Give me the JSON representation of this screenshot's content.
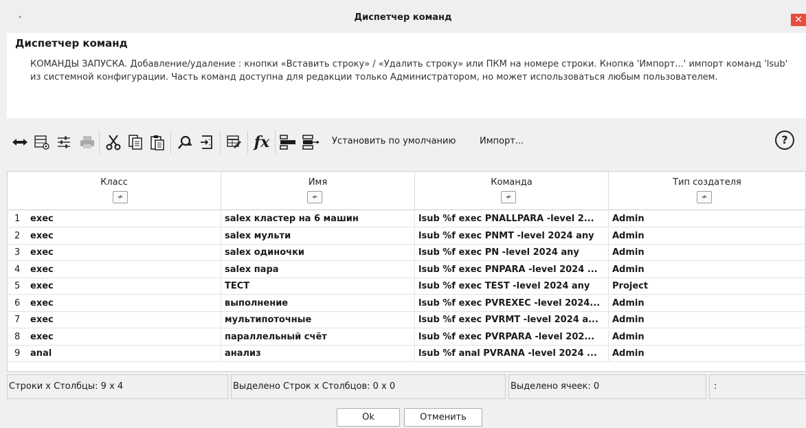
{
  "window": {
    "title": "Диспетчер команд",
    "close_glyph": "✕"
  },
  "header": {
    "heading": "Диспетчер команд",
    "description": "КОМАНДЫ ЗАПУСКА. Добавление/удаление : кнопки «Вставить строку» / «Удалить строку» или ПКМ на номере строки. Кнопка 'Импорт...' импорт команд 'lsub' из системной конфигурации. Часть команд доступна для редакции только Администратором, но может использоваться любым пользователем."
  },
  "toolbar": {
    "icons": [
      "resize-columns-icon",
      "view-table-icon",
      "settings-lines-icon",
      "print-icon",
      "cut-icon",
      "copy-icon",
      "paste-icon",
      "search-replace-icon",
      "goto-icon",
      "edit-table-icon",
      "function-icon",
      "insert-row-icon",
      "delete-row-icon"
    ],
    "set_default_label": "Установить по умолчанию",
    "import_label": "Импорт...",
    "help_glyph": "?"
  },
  "table": {
    "columns": [
      "Класс",
      "Имя",
      "Команда",
      "Тип создателя"
    ],
    "filter_glyph": "≁",
    "rows": [
      {
        "num": "1",
        "cls": "exec",
        "name": "salex кластер на 6 машин",
        "cmd": "lsub %f exec PNALLPARA -level 2...",
        "creator": "Admin"
      },
      {
        "num": "2",
        "cls": "exec",
        "name": "salex мульти",
        "cmd": "lsub %f exec PNMT -level 2024 any",
        "creator": "Admin"
      },
      {
        "num": "3",
        "cls": "exec",
        "name": "salex одиночки",
        "cmd": "lsub %f exec PN -level 2024 any",
        "creator": "Admin"
      },
      {
        "num": "4",
        "cls": "exec",
        "name": "salex пара",
        "cmd": "lsub %f exec PNPARA -level 2024 ...",
        "creator": "Admin"
      },
      {
        "num": "5",
        "cls": "exec",
        "name": "ТЕСТ",
        "cmd": "lsub %f exec TEST -level 2024 any",
        "creator": "Project"
      },
      {
        "num": "6",
        "cls": "exec",
        "name": "выполнение",
        "cmd": "lsub %f exec PVREXEC -level 2024...",
        "creator": "Admin"
      },
      {
        "num": "7",
        "cls": "exec",
        "name": "мультипоточные",
        "cmd": "lsub %f exec PVRMT -level 2024 a...",
        "creator": "Admin"
      },
      {
        "num": "8",
        "cls": "exec",
        "name": "параллельный счёт",
        "cmd": "lsub %f exec PVRPARA -level 202...",
        "creator": "Admin"
      },
      {
        "num": "9",
        "cls": "anal",
        "name": "анализ",
        "cmd": "lsub %f anal PVRANA -level 2024 ...",
        "creator": "Admin"
      }
    ]
  },
  "status": {
    "rows_cols": "Строки х Столбцы:  9 x 4",
    "selected_rows_cols": "Выделено Строк х Столбцов:  0 x 0",
    "selected_cells": "Выделено ячеек:  0",
    "extra": ":"
  },
  "buttons": {
    "ok": "Ok",
    "cancel": "Отменить"
  }
}
